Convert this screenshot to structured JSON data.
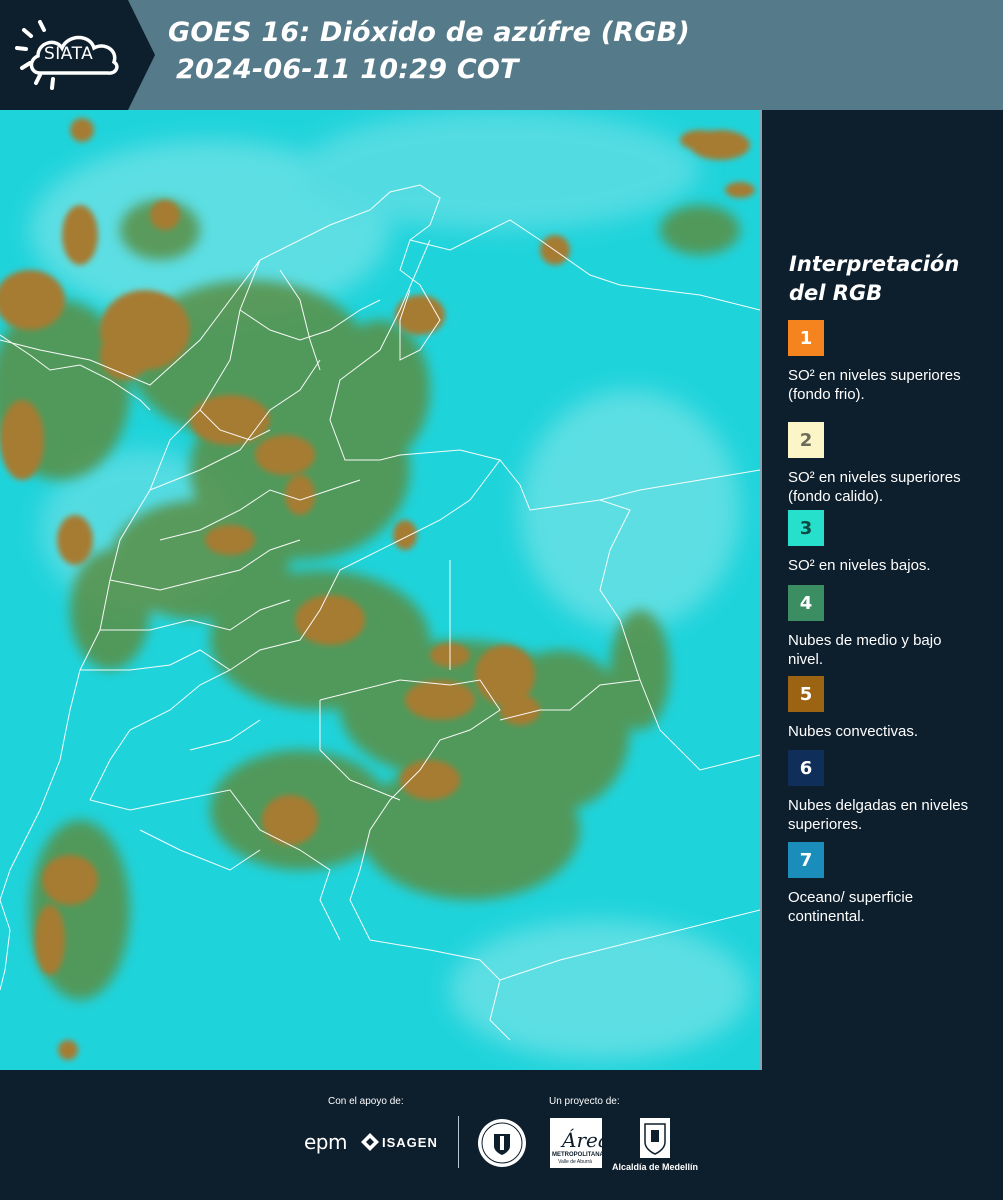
{
  "header": {
    "logo_text": "SIATA",
    "title_line1": "GOES 16: Dióxido de azúfre (RGB)",
    "title_line2": "2024-06-11 10:29 COT"
  },
  "map": {
    "background_color": "#1fd3db",
    "cloud_green": "#5a8f44",
    "cloud_brown": "#a67c33",
    "border_color": "#ffffff"
  },
  "legend": {
    "title_line1": "Interpretación",
    "title_line2": "del RGB",
    "items": [
      {
        "number": "1",
        "color": "#f5841f",
        "label": "SO² en niveles superiores (fondo frio)."
      },
      {
        "number": "2",
        "color": "#fbf5c8",
        "label": "SO² en niveles superiores (fondo calido)."
      },
      {
        "number": "3",
        "color": "#27e0cc",
        "label": "SO² en niveles bajos."
      },
      {
        "number": "4",
        "color": "#3b8e62",
        "label": "Nubes de medio y bajo nivel."
      },
      {
        "number": "5",
        "color": "#9c6412",
        "label": "Nubes convectivas."
      },
      {
        "number": "6",
        "color": "#0f2f5a",
        "label": "Nubes delgadas en niveles superiores."
      },
      {
        "number": "7",
        "color": "#1a8dba",
        "label": "Oceano/ superficie continental."
      }
    ]
  },
  "footer": {
    "support_label": "Con el apoyo de:",
    "project_label": "Un proyecto de:",
    "epm": "epm",
    "isagen": "ISAGEN",
    "area_script": "Área",
    "area_name": "METROPOLITANA",
    "area_sub": "Valle de Aburrá",
    "alcaldia": "Alcaldía de Medellín"
  }
}
